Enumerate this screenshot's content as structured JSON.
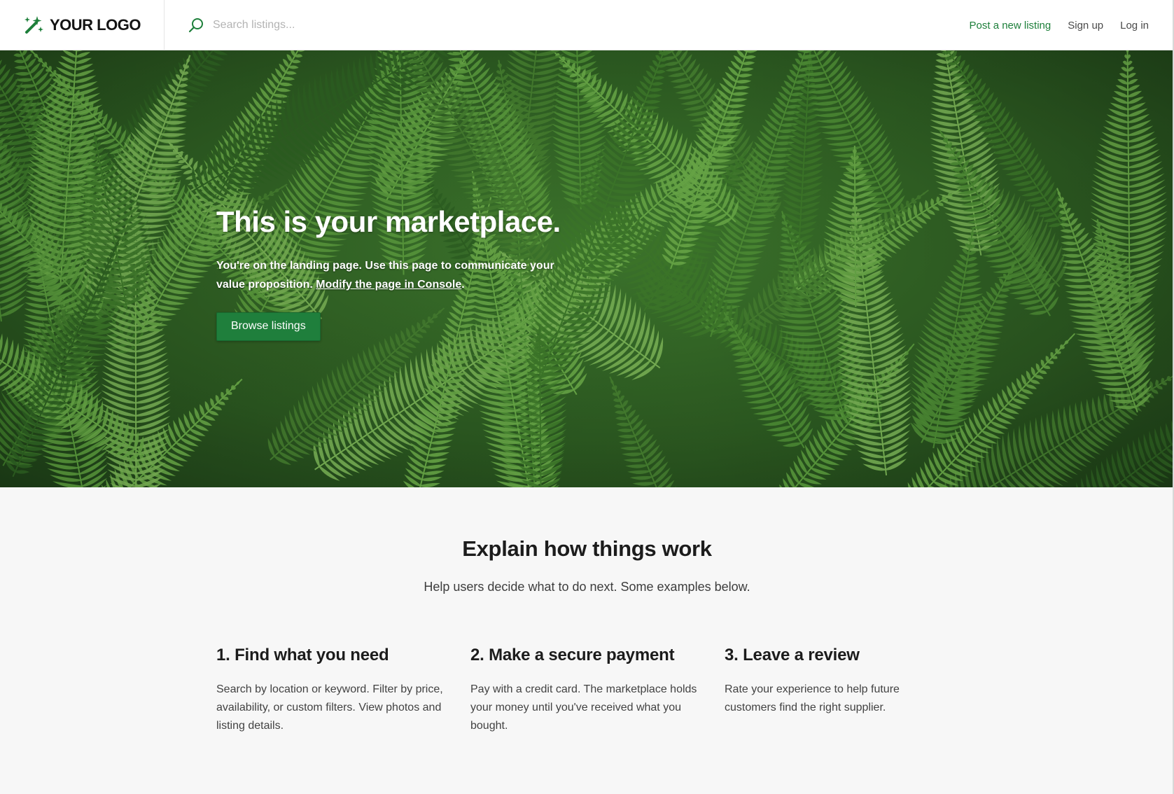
{
  "header": {
    "logo_text": "YOUR LOGO",
    "logo_icon": "magic-wand-sparkle-icon",
    "search_icon": "search-icon",
    "search_placeholder": "Search listings...",
    "nav": {
      "post_listing": "Post a new listing",
      "sign_up": "Sign up",
      "log_in": "Log in"
    },
    "accent_color": "#1d7f3a"
  },
  "hero": {
    "title": "This is your marketplace.",
    "text_before_link": "You're on the landing page. Use this page to communicate your value proposition. ",
    "link_text": "Modify the page in Console",
    "text_after_link": ".",
    "button_label": "Browse listings",
    "background": "green fern leaves photo",
    "button_color": "#1f7f3c"
  },
  "how_it_works": {
    "title": "Explain how things work",
    "subtitle": "Help users decide what to do next. Some examples below.",
    "steps": [
      {
        "title": "1. Find what you need",
        "text": "Search by location or keyword. Filter by price, availability, or custom filters. View photos and listing details."
      },
      {
        "title": "2. Make a secure payment",
        "text": "Pay with a credit card. The marketplace holds your money until you've received what you bought."
      },
      {
        "title": "3. Leave a review",
        "text": "Rate your experience to help future customers find the right supplier."
      }
    ]
  }
}
